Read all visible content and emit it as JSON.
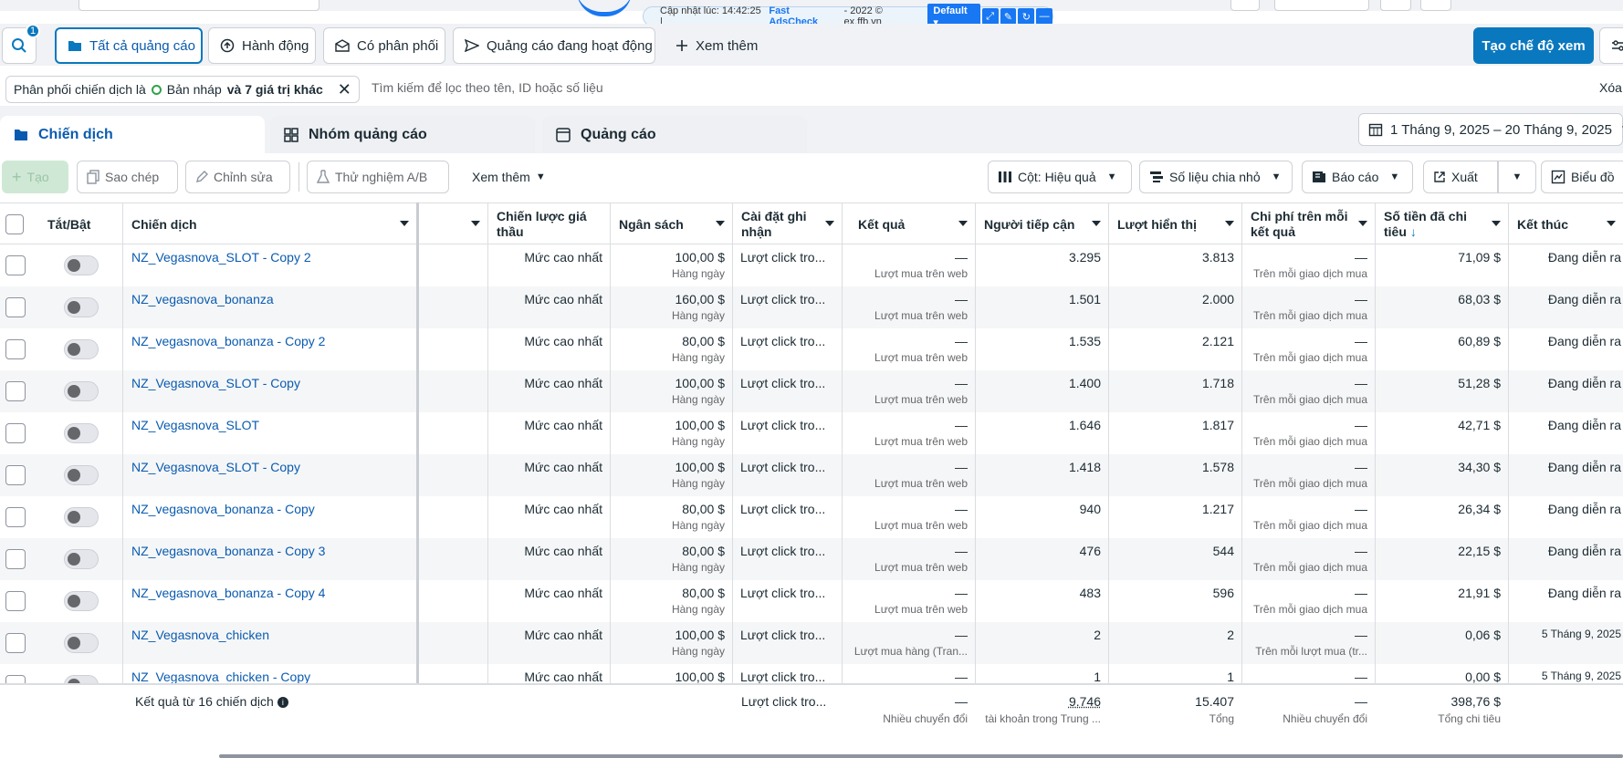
{
  "overlay": {
    "update_text": "Cập nhật lúc: 14:42:25 |",
    "brand": "Fast AdsCheck",
    "suffix": "- 2022 © ex.ffb.vn",
    "profile": "Default"
  },
  "toolbar": {
    "search_badge": "1",
    "all_ads": "Tất cả quảng cáo",
    "actions": "Hành động",
    "delivering": "Có phân phối",
    "active_ads": "Quảng cáo đang hoạt động",
    "see_more": "Xem thêm",
    "create_view": "Tạo chế độ xem"
  },
  "filter": {
    "chip_prefix": "Phân phối chiến dịch là",
    "chip_value": "Bản nháp",
    "chip_more": "và 7 giá trị khác",
    "search_placeholder": "Tìm kiếm để lọc theo tên, ID hoặc số liệu",
    "clear": "Xóa"
  },
  "tabs": {
    "campaigns": "Chiến dịch",
    "adsets": "Nhóm quảng cáo",
    "ads": "Quảng cáo",
    "date_range": "1 Tháng 9, 2025 – 20 Tháng 9, 2025"
  },
  "actions": {
    "create": "Tạo",
    "duplicate": "Sao chép",
    "edit": "Chỉnh sửa",
    "ab_test": "Thử nghiệm A/B",
    "more": "Xem thêm",
    "columns": "Cột: Hiệu quả",
    "breakdown": "Số liệu chia nhỏ",
    "reports": "Báo cáo",
    "export": "Xuất",
    "charts": "Biểu đồ"
  },
  "columns": {
    "toggle": "Tắt/Bật",
    "campaign": "Chiến dịch",
    "bid_strategy": "Chiến lược giá thầu",
    "budget": "Ngân sách",
    "attribution": "Cài đặt ghi nhận",
    "results": "Kết quả",
    "reach": "Người tiếp cận",
    "impressions": "Lượt hiển thị",
    "cost_per_result": "Chi phí trên mỗi kết quả",
    "amount_spent": "Số tiền đã chi tiêu",
    "ends": "Kết thúc"
  },
  "rows": [
    {
      "name": "NZ_Vegasnova_SLOT - Copy 2",
      "bid": "Mức cao nhất",
      "budget": "100,00 $",
      "budget_sub": "Hàng ngày",
      "attr": "Lượt click tro...",
      "result": "—",
      "result_sub": "Lượt mua trên web",
      "reach": "3.295",
      "impr": "3.813",
      "cpr": "—",
      "cpr_sub": "Trên mỗi giao dịch mua",
      "spent": "71,09 $",
      "ends": "Đang diễn ra"
    },
    {
      "name": "NZ_vegasnova_bonanza",
      "bid": "Mức cao nhất",
      "budget": "160,00 $",
      "budget_sub": "Hàng ngày",
      "attr": "Lượt click tro...",
      "result": "—",
      "result_sub": "Lượt mua trên web",
      "reach": "1.501",
      "impr": "2.000",
      "cpr": "—",
      "cpr_sub": "Trên mỗi giao dịch mua",
      "spent": "68,03 $",
      "ends": "Đang diễn ra"
    },
    {
      "name": "NZ_vegasnova_bonanza - Copy 2",
      "bid": "Mức cao nhất",
      "budget": "80,00 $",
      "budget_sub": "Hàng ngày",
      "attr": "Lượt click tro...",
      "result": "—",
      "result_sub": "Lượt mua trên web",
      "reach": "1.535",
      "impr": "2.121",
      "cpr": "—",
      "cpr_sub": "Trên mỗi giao dịch mua",
      "spent": "60,89 $",
      "ends": "Đang diễn ra"
    },
    {
      "name": "NZ_Vegasnova_SLOT - Copy",
      "bid": "Mức cao nhất",
      "budget": "100,00 $",
      "budget_sub": "Hàng ngày",
      "attr": "Lượt click tro...",
      "result": "—",
      "result_sub": "Lượt mua trên web",
      "reach": "1.400",
      "impr": "1.718",
      "cpr": "—",
      "cpr_sub": "Trên mỗi giao dịch mua",
      "spent": "51,28 $",
      "ends": "Đang diễn ra"
    },
    {
      "name": "NZ_Vegasnova_SLOT",
      "bid": "Mức cao nhất",
      "budget": "100,00 $",
      "budget_sub": "Hàng ngày",
      "attr": "Lượt click tro...",
      "result": "—",
      "result_sub": "Lượt mua trên web",
      "reach": "1.646",
      "impr": "1.817",
      "cpr": "—",
      "cpr_sub": "Trên mỗi giao dịch mua",
      "spent": "42,71 $",
      "ends": "Đang diễn ra"
    },
    {
      "name": "NZ_Vegasnova_SLOT - Copy",
      "bid": "Mức cao nhất",
      "budget": "100,00 $",
      "budget_sub": "Hàng ngày",
      "attr": "Lượt click tro...",
      "result": "—",
      "result_sub": "Lượt mua trên web",
      "reach": "1.418",
      "impr": "1.578",
      "cpr": "—",
      "cpr_sub": "Trên mỗi giao dịch mua",
      "spent": "34,30 $",
      "ends": "Đang diễn ra"
    },
    {
      "name": "NZ_vegasnova_bonanza - Copy",
      "bid": "Mức cao nhất",
      "budget": "80,00 $",
      "budget_sub": "Hàng ngày",
      "attr": "Lượt click tro...",
      "result": "—",
      "result_sub": "Lượt mua trên web",
      "reach": "940",
      "impr": "1.217",
      "cpr": "—",
      "cpr_sub": "Trên mỗi giao dịch mua",
      "spent": "26,34 $",
      "ends": "Đang diễn ra"
    },
    {
      "name": "NZ_vegasnova_bonanza - Copy 3",
      "bid": "Mức cao nhất",
      "budget": "80,00 $",
      "budget_sub": "Hàng ngày",
      "attr": "Lượt click tro...",
      "result": "—",
      "result_sub": "Lượt mua trên web",
      "reach": "476",
      "impr": "544",
      "cpr": "—",
      "cpr_sub": "Trên mỗi giao dịch mua",
      "spent": "22,15 $",
      "ends": "Đang diễn ra"
    },
    {
      "name": "NZ_vegasnova_bonanza - Copy 4",
      "bid": "Mức cao nhất",
      "budget": "80,00 $",
      "budget_sub": "Hàng ngày",
      "attr": "Lượt click tro...",
      "result": "—",
      "result_sub": "Lượt mua trên web",
      "reach": "483",
      "impr": "596",
      "cpr": "—",
      "cpr_sub": "Trên mỗi giao dịch mua",
      "spent": "21,91 $",
      "ends": "Đang diễn ra"
    },
    {
      "name": "NZ_Vegasnova_chicken",
      "bid": "Mức cao nhất",
      "budget": "100,00 $",
      "budget_sub": "Hàng ngày",
      "attr": "Lượt click tro...",
      "result": "—",
      "result_sub": "Lượt mua hàng (Tran...",
      "reach": "2",
      "impr": "2",
      "cpr": "—",
      "cpr_sub": "Trên mỗi lượt mua (tr...",
      "spent": "0,06 $",
      "ends": "5 Tháng 9, 2025"
    },
    {
      "name": "NZ_Vegasnova_chicken - Copy",
      "bid": "Mức cao nhất",
      "budget": "100,00 $",
      "budget_sub": "",
      "attr": "Lượt click tro...",
      "result": "—",
      "result_sub": "",
      "reach": "1",
      "impr": "1",
      "cpr": "—",
      "cpr_sub": "",
      "spent": "0,00 $",
      "ends": "5 Tháng 9, 2025"
    }
  ],
  "footer": {
    "label": "Kết quả từ 16 chiến dịch",
    "attr": "Lượt click tro...",
    "result": "—",
    "result_sub": "Nhiều chuyển đổi",
    "reach": "9.746",
    "reach_sub": "tài khoản trong Trung ...",
    "impr": "15.407",
    "impr_sub": "Tổng",
    "cpr": "—",
    "cpr_sub": "Nhiều chuyển đổi",
    "spent": "398,76 $",
    "spent_sub": "Tổng chi tiêu"
  },
  "colors": {
    "primary": "#0a78be",
    "link": "#0a5bb0",
    "green": "#31a24c"
  }
}
